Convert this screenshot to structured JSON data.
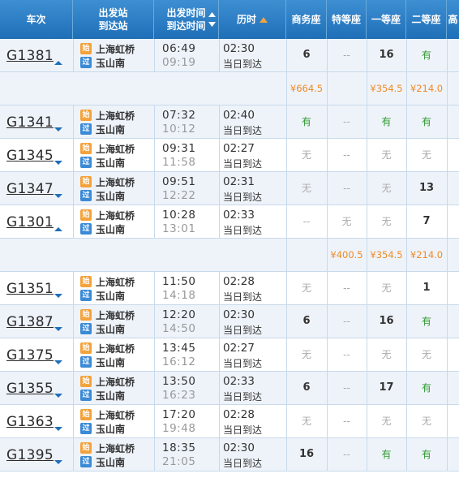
{
  "header": {
    "train_col": "车次",
    "station_col_1": "出发站",
    "station_col_2": "到达站",
    "time_col_1": "出发时间",
    "time_col_2": "到达时间",
    "duration_col": "历时",
    "business": "商务座",
    "special": "特等座",
    "first": "一等座",
    "second": "二等座",
    "extra": "高"
  },
  "badges": {
    "start": "始",
    "pass": "过"
  },
  "colors": {
    "header": "#2a7fc8",
    "yes": "#2f9a2f",
    "price": "#f08a24",
    "arrow": "#1f6fb8"
  },
  "trains": [
    {
      "no": "G1381",
      "from": "上海虹桥",
      "to": "玉山南",
      "dep": "06:49",
      "arr": "09:19",
      "dur": "02:30",
      "day": "当日到达",
      "business": "6",
      "special": "--",
      "first": "16",
      "second": "有",
      "expanded": true
    },
    {
      "no": "G1341",
      "from": "上海虹桥",
      "to": "玉山南",
      "dep": "07:32",
      "arr": "10:12",
      "dur": "02:40",
      "day": "当日到达",
      "business": "有",
      "special": "--",
      "first": "有",
      "second": "有",
      "expanded": false
    },
    {
      "no": "G1345",
      "from": "上海虹桥",
      "to": "玉山南",
      "dep": "09:31",
      "arr": "11:58",
      "dur": "02:27",
      "day": "当日到达",
      "business": "无",
      "special": "--",
      "first": "无",
      "second": "无",
      "expanded": false
    },
    {
      "no": "G1347",
      "from": "上海虹桥",
      "to": "玉山南",
      "dep": "09:51",
      "arr": "12:22",
      "dur": "02:31",
      "day": "当日到达",
      "business": "无",
      "special": "--",
      "first": "无",
      "second": "13",
      "expanded": false
    },
    {
      "no": "G1301",
      "from": "上海虹桥",
      "to": "玉山南",
      "dep": "10:28",
      "arr": "13:01",
      "dur": "02:33",
      "day": "当日到达",
      "business": "--",
      "special": "无",
      "first": "无",
      "second": "7",
      "expanded": true
    },
    {
      "no": "G1351",
      "from": "上海虹桥",
      "to": "玉山南",
      "dep": "11:50",
      "arr": "14:18",
      "dur": "02:28",
      "day": "当日到达",
      "business": "无",
      "special": "--",
      "first": "无",
      "second": "1",
      "expanded": false
    },
    {
      "no": "G1387",
      "from": "上海虹桥",
      "to": "玉山南",
      "dep": "12:20",
      "arr": "14:50",
      "dur": "02:30",
      "day": "当日到达",
      "business": "6",
      "special": "--",
      "first": "16",
      "second": "有",
      "expanded": false
    },
    {
      "no": "G1375",
      "from": "上海虹桥",
      "to": "玉山南",
      "dep": "13:45",
      "arr": "16:12",
      "dur": "02:27",
      "day": "当日到达",
      "business": "无",
      "special": "--",
      "first": "无",
      "second": "无",
      "expanded": false
    },
    {
      "no": "G1355",
      "from": "上海虹桥",
      "to": "玉山南",
      "dep": "13:50",
      "arr": "16:23",
      "dur": "02:33",
      "day": "当日到达",
      "business": "6",
      "special": "--",
      "first": "17",
      "second": "有",
      "expanded": false
    },
    {
      "no": "G1363",
      "from": "上海虹桥",
      "to": "玉山南",
      "dep": "17:20",
      "arr": "19:48",
      "dur": "02:28",
      "day": "当日到达",
      "business": "无",
      "special": "--",
      "first": "无",
      "second": "无",
      "expanded": false
    },
    {
      "no": "G1395",
      "from": "上海虹桥",
      "to": "玉山南",
      "dep": "18:35",
      "arr": "21:05",
      "dur": "02:30",
      "day": "当日到达",
      "business": "16",
      "special": "--",
      "first": "有",
      "second": "有",
      "expanded": false
    }
  ],
  "prices": {
    "G1381": {
      "business": "¥664.5",
      "special": "",
      "first": "¥354.5",
      "second": "¥214.0"
    },
    "G1301": {
      "business": "",
      "special": "¥400.5",
      "first": "¥354.5",
      "second": "¥214.0"
    }
  }
}
